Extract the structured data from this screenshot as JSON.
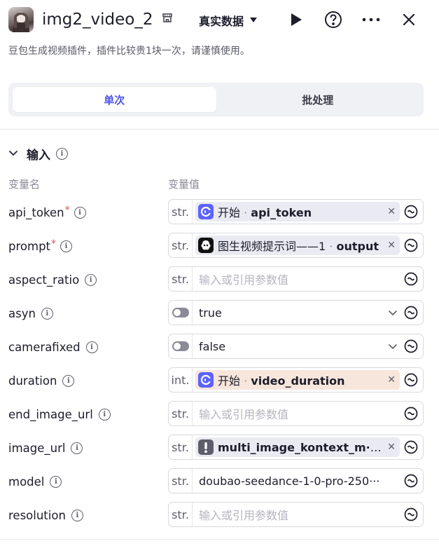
{
  "header": {
    "title": "img2_video_2",
    "data_select": "真实数据",
    "icons": [
      "store-icon",
      "play-icon",
      "help-icon",
      "more-icon",
      "close-icon"
    ]
  },
  "description": "豆包生成视频插件，插件比较贵1块一次，请谨慎使用。",
  "tabs": [
    {
      "label": "单次",
      "active": true
    },
    {
      "label": "批处理",
      "active": false
    }
  ],
  "section": {
    "label": "输入"
  },
  "columns": {
    "name": "变量名",
    "value": "变量值"
  },
  "colors": {
    "accent": "#4d53e8",
    "required": "#e54848",
    "ref_chip": "#e9eaf2",
    "ref_chip_warn": "#f7e6dc"
  },
  "params": [
    {
      "name": "api_token",
      "required": true,
      "type": "str.",
      "kind": "ref",
      "source": "开始",
      "sep": " · ",
      "field": "api_token",
      "icon": "start-node-icon"
    },
    {
      "name": "prompt",
      "required": true,
      "type": "str.",
      "kind": "ref",
      "source": "图生视频提示词——1",
      "sep": " · ",
      "field": "output",
      "icon": "llm-node-icon"
    },
    {
      "name": "aspect_ratio",
      "required": false,
      "type": "str.",
      "kind": "placeholder",
      "placeholder": "输入或引用参数值"
    },
    {
      "name": "asyn",
      "required": false,
      "type": "toggle",
      "kind": "bool",
      "value": "true"
    },
    {
      "name": "camerafixed",
      "required": false,
      "type": "toggle",
      "kind": "bool",
      "value": "false"
    },
    {
      "name": "duration",
      "required": false,
      "type": "int.",
      "kind": "ref",
      "source": "开始",
      "sep": " · ",
      "field": "video_duration",
      "icon": "start-node-icon"
    },
    {
      "name": "end_image_url",
      "required": false,
      "type": "str.",
      "kind": "placeholder",
      "placeholder": "输入或引用参数值"
    },
    {
      "name": "image_url",
      "required": false,
      "type": "str.",
      "kind": "ref",
      "source": "",
      "sep": "",
      "field": "multi_image_kontext_m··· ·",
      "icon": "warning-node-icon"
    },
    {
      "name": "model",
      "required": false,
      "type": "str.",
      "kind": "text",
      "value": "doubao-seedance-1-0-pro-250···"
    },
    {
      "name": "resolution",
      "required": false,
      "type": "str.",
      "kind": "placeholder",
      "placeholder": "输入或引用参数值"
    }
  ]
}
